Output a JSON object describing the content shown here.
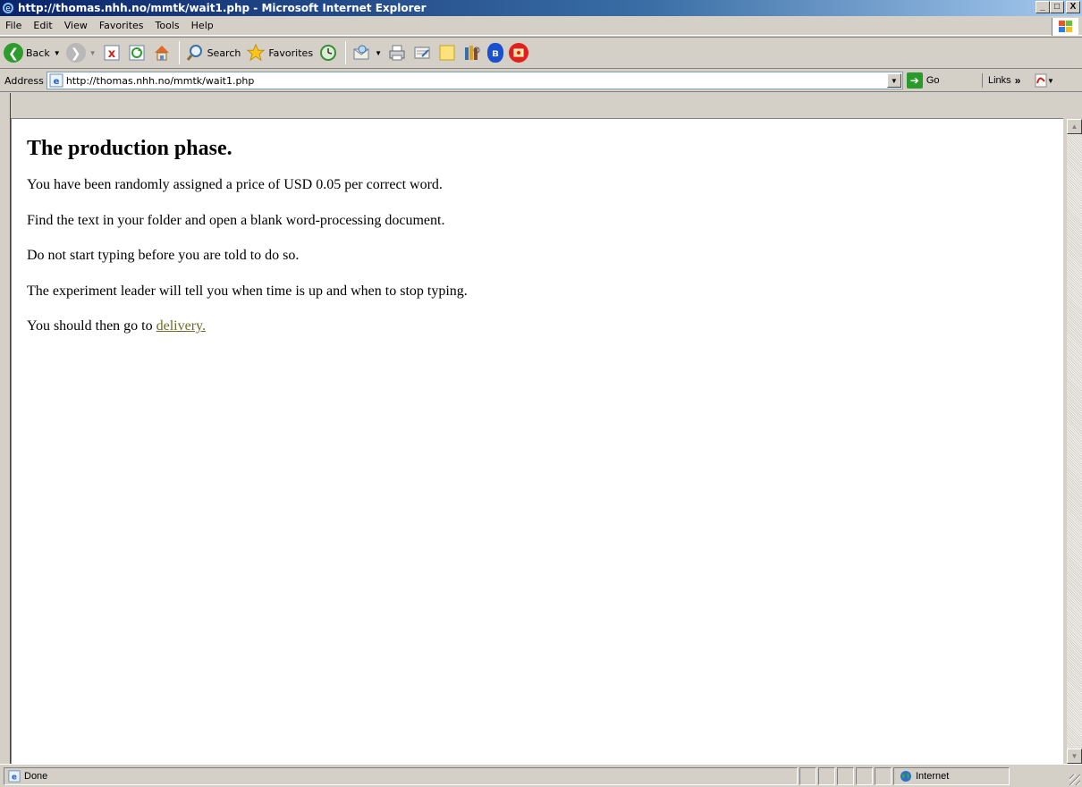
{
  "window": {
    "title": "http://thomas.nhh.no/mmtk/wait1.php - Microsoft Internet Explorer",
    "minimize": "_",
    "maximize": "□",
    "close": "X"
  },
  "menu": {
    "items": [
      {
        "label": "File"
      },
      {
        "label": "Edit"
      },
      {
        "label": "View"
      },
      {
        "label": "Favorites"
      },
      {
        "label": "Tools"
      },
      {
        "label": "Help"
      }
    ]
  },
  "toolbar": {
    "back_label": "Back",
    "search_label": "Search",
    "favorites_label": "Favorites"
  },
  "address": {
    "label": "Address",
    "url": "http://thomas.nhh.no/mmtk/wait1.php",
    "go_label": "Go",
    "links_label": "Links"
  },
  "page": {
    "heading": "The production phase.",
    "paragraphs": [
      "You have been randomly assigned a price of USD 0.05 per correct word.",
      "Find the text in your folder and open a blank word-processing document.",
      "Do not start typing before you are told to do so.",
      "The experiment leader will tell you when time is up and when to stop typing."
    ],
    "delivery_prefix": "You should then go to ",
    "delivery_link": "delivery."
  },
  "status": {
    "text": "Done",
    "zone": "Internet"
  },
  "colors": {
    "titlebar_start": "#0a246a",
    "titlebar_end": "#a6caf0",
    "chrome": "#d4d0c8",
    "link": "#6b6b2a"
  }
}
